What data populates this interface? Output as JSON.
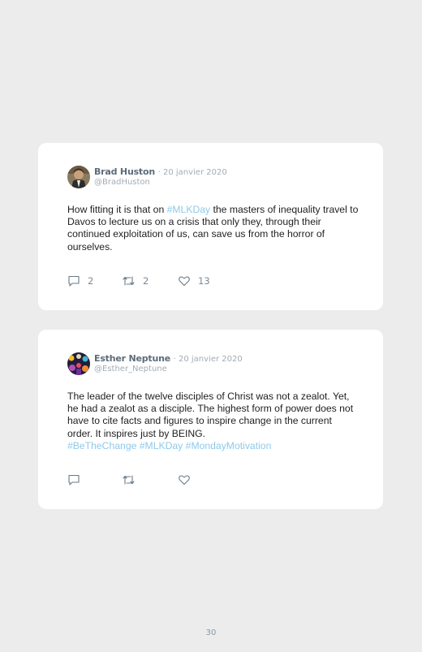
{
  "tweets": [
    {
      "author": "Brad Huston",
      "date": "· 20 janvier 2020",
      "handle": "@BradHuston",
      "text_parts": [
        "How fitting it is that on ",
        "#MLKDay",
        " the masters of inequality travel to Davos to lecture us on a crisis that only they, through their continued exploitation of us, can save us from the horror of ourselves."
      ],
      "replies": "2",
      "retweets": "2",
      "likes": "13"
    },
    {
      "author": "Esther Neptune",
      "date": "· 20 janvier 2020",
      "handle": "@Esther_Neptune",
      "text_parts": [
        "The leader of the twelve disciples of Christ was not a zealot. Yet, he had a zealot as a disciple. The highest form of power does not have to cite facts and figures to inspire change in the current order. It inspires just by BEING.",
        "#BeTheChange #MLKDay #MondayMotivation"
      ]
    }
  ],
  "page_number": "30",
  "colors": {
    "hashtag": "#8ec9ea",
    "background": "#ececec",
    "card": "#ffffff"
  }
}
